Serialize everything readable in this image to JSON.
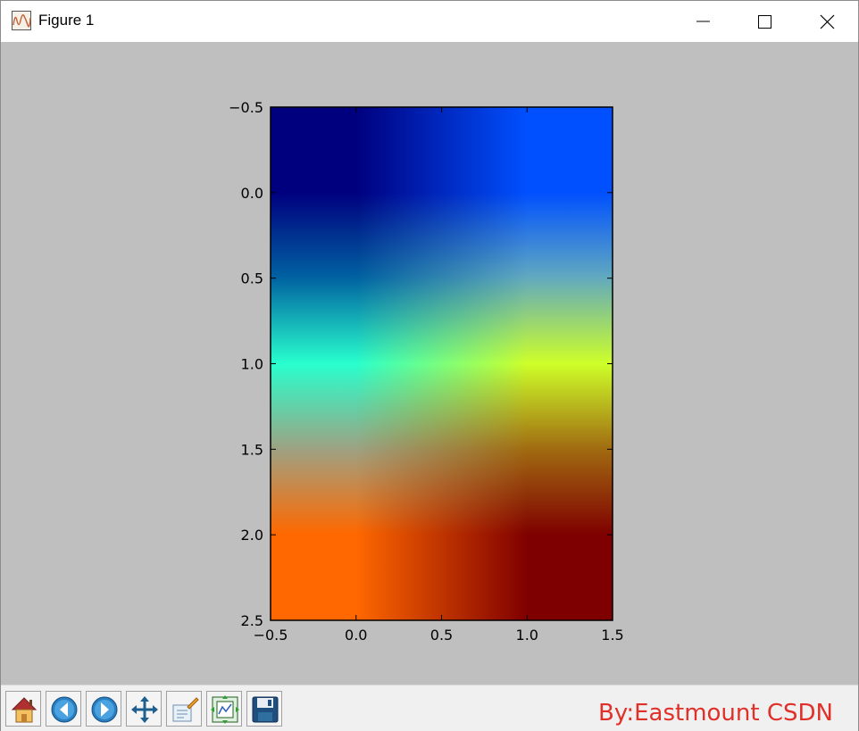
{
  "window": {
    "title": "Figure 1",
    "icons": {
      "app": "matplotlib-figure-icon",
      "minimize": "minimize-icon",
      "maximize": "maximize-icon",
      "close": "close-icon"
    }
  },
  "toolbar": {
    "buttons": [
      {
        "name": "home",
        "icon": "home-icon"
      },
      {
        "name": "back",
        "icon": "back-arrow-icon"
      },
      {
        "name": "forward",
        "icon": "forward-arrow-icon"
      },
      {
        "name": "pan",
        "icon": "pan-move-icon"
      },
      {
        "name": "zoom",
        "icon": "zoom-rect-icon"
      },
      {
        "name": "subplots",
        "icon": "subplots-config-icon"
      },
      {
        "name": "save",
        "icon": "save-floppy-icon"
      }
    ]
  },
  "watermark": {
    "text": "By:Eastmount CSDN",
    "color": "#e0302a"
  },
  "chart_data": {
    "type": "heatmap",
    "title": "",
    "xlabel": "",
    "ylabel": "",
    "interpolation": "bilinear",
    "colormap": "jet",
    "xlim": [
      -0.5,
      1.5
    ],
    "ylim": [
      2.5,
      -0.5
    ],
    "y_axis_inverted": true,
    "x_ticks": [
      "−0.5",
      "0.0",
      "0.5",
      "1.0",
      "1.5"
    ],
    "y_ticks": [
      "−0.5",
      "0.0",
      "0.5",
      "1.0",
      "1.5",
      "2.0",
      "2.5"
    ],
    "x_tick_values": [
      -0.5,
      0.0,
      0.5,
      1.0,
      1.5
    ],
    "y_tick_values": [
      -0.5,
      0.0,
      0.5,
      1.0,
      1.5,
      2.0,
      2.5
    ],
    "rows": 3,
    "cols": 2,
    "cells_colors": [
      [
        "#00007f",
        "#0050ff"
      ],
      [
        "#29ffce",
        "#ceff29"
      ],
      [
        "#ff6800",
        "#7f0000"
      ]
    ],
    "grid": false,
    "background": "#bfbfbf"
  }
}
